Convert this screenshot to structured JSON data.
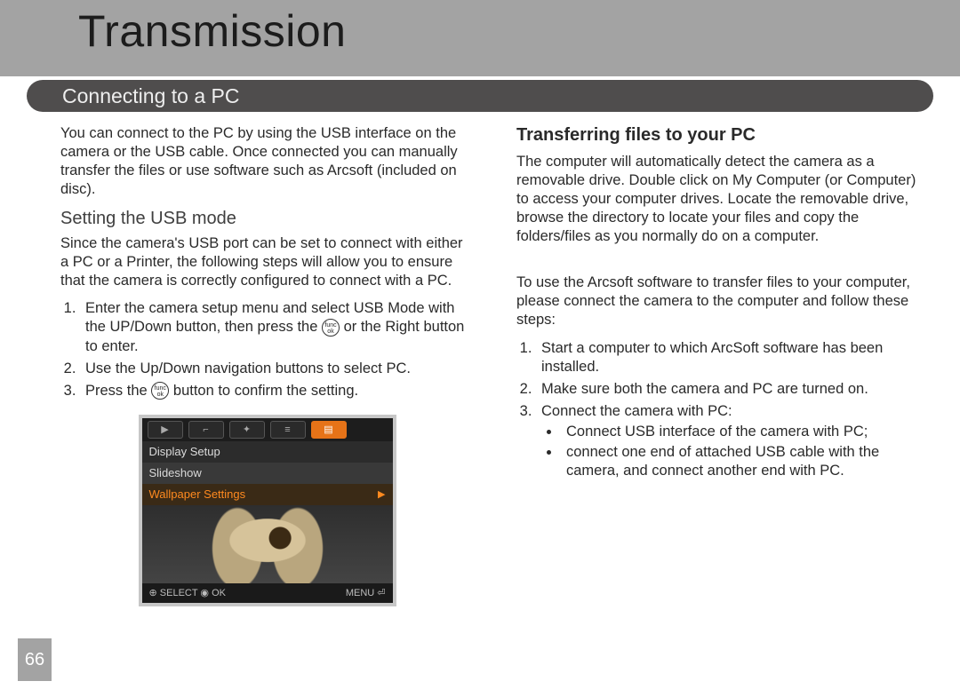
{
  "header": {
    "title": "Transmission"
  },
  "section": {
    "title": "Connecting to a PC"
  },
  "left": {
    "intro": "You can connect to the PC by using the USB interface on the camera or the USB cable.  Once connected you can manually transfer the files or use software such as Arcsoft (included on disc).",
    "usb_heading": "Setting the USB mode",
    "usb_intro": "Since the camera's USB port can be set to connect with either a PC or a Printer, the following steps will allow you to ensure that the camera is correctly configured to connect with a PC.",
    "step1_a": "Enter the camera setup menu and select USB Mode with the UP/Down button, then press the ",
    "step1_b": " or the Right button to enter.",
    "step2": "Use the Up/Down navigation buttons to select PC.",
    "step3_a": "Press the ",
    "step3_b": " button to confirm the setting.",
    "func_btn_top": "func",
    "func_btn_bot": "ok"
  },
  "lcd": {
    "tab_play": "▶",
    "tab_key": "⌐",
    "tab_tool": "✦",
    "tab_set": "≡",
    "tab_img": "▤",
    "row_display": "Display Setup",
    "row_slide": "Slideshow",
    "row_wall": "Wallpaper Settings",
    "footer_left": "⊕ SELECT    ◉ OK",
    "footer_right": "MENU ⏎"
  },
  "right": {
    "heading": "Transferring files to your PC",
    "p1": "The computer will automatically detect the camera as a removable drive.  Double click on My Computer (or Computer) to access your computer drives.  Locate the removable drive, browse the directory to locate your files and copy the folders/files as you normally do on a computer.",
    "p2": "To use the Arcsoft software to transfer files to your computer, please connect the camera to the computer and follow these steps:",
    "s1": "Start a computer to which ArcSoft software has been installed.",
    "s2": "Make sure both the camera and PC are turned on.",
    "s3": "Connect the camera with PC:",
    "b1": "Connect USB interface of the camera with PC;",
    "b2": "connect one end of attached USB cable with the camera, and connect another end with PC."
  },
  "page_number": "66"
}
